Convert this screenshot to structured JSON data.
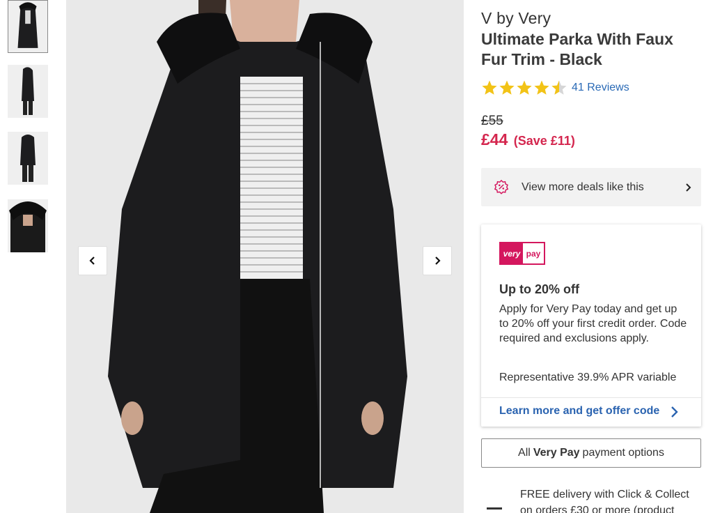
{
  "gallery": {
    "thumbnails": [
      {
        "label": "front view"
      },
      {
        "label": "side view"
      },
      {
        "label": "back view"
      },
      {
        "label": "hood detail"
      }
    ],
    "active_index": 0
  },
  "product": {
    "brand": "V by Very",
    "title": "Ultimate Parka With Faux Fur Trim - Black",
    "rating": 4.5,
    "reviews_label": "41 Reviews",
    "was_price": "£55",
    "now_price": "£44",
    "save_label": "(Save £11)"
  },
  "deals": {
    "label": "View more deals like this"
  },
  "very_pay": {
    "logo_left": "very",
    "logo_right": "pay",
    "heading": "Up to 20% off",
    "body": "Apply for Very Pay today and get up to 20% off your first credit order. Code required and exclusions apply.",
    "apr": "Representative 39.9% APR variable",
    "link_label": "Learn more and get offer code"
  },
  "payment_options": {
    "prefix": "All",
    "bold": "Very Pay",
    "suffix": "payment options"
  },
  "delivery": {
    "text": "FREE delivery with Click & Collect on orders £30 or more (product"
  },
  "colors": {
    "price_red": "#d4264e",
    "link_blue": "#2a63b0",
    "star_yellow": "#f2c317",
    "very_pink": "#d4175e"
  }
}
